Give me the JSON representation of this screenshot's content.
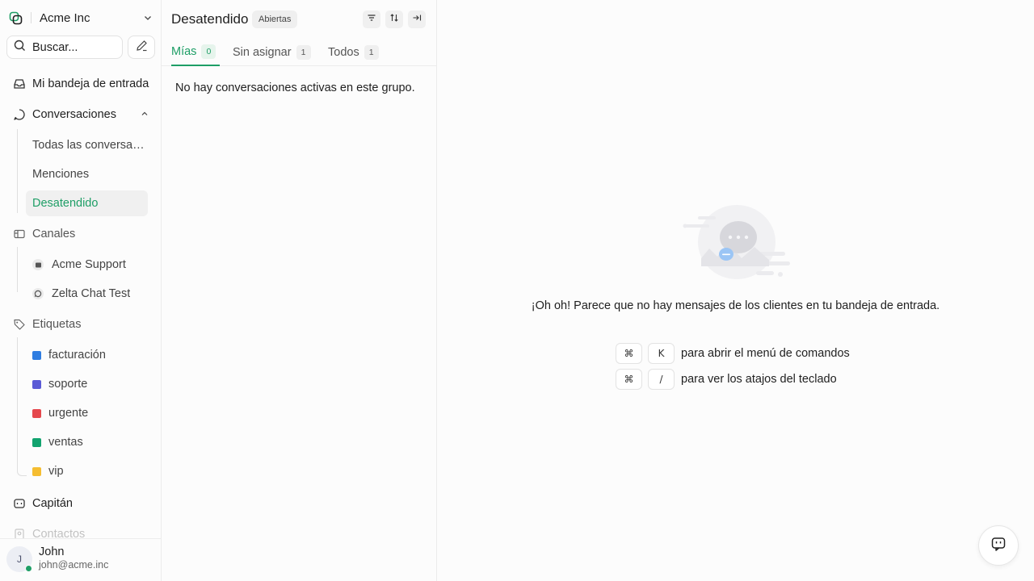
{
  "sidebar": {
    "account_name": "Acme Inc",
    "search_placeholder": "Buscar...",
    "nav": {
      "inbox": "Mi bandeja de entrada",
      "conversations": "Conversaciones",
      "channels": "Canales",
      "labels": "Etiquetas",
      "captain": "Capitán",
      "contacts": "Contactos"
    },
    "conversation_views": [
      "Todas las conversaciones",
      "Menciones",
      "Desatendido"
    ],
    "channels": [
      {
        "name": "Acme Support",
        "icon": "globe-icon"
      },
      {
        "name": "Zelta Chat Test",
        "icon": "whatsapp-icon"
      }
    ],
    "labels": [
      {
        "name": "facturación",
        "color": "#2f7de1"
      },
      {
        "name": "soporte",
        "color": "#5b5bd6"
      },
      {
        "name": "urgente",
        "color": "#e5484d"
      },
      {
        "name": "ventas",
        "color": "#12a36f"
      },
      {
        "name": "vip",
        "color": "#f5bd31"
      }
    ],
    "user": {
      "initial": "J",
      "name": "John",
      "email": "john@acme.inc"
    }
  },
  "list": {
    "title": "Desatendido",
    "status": "Abiertas",
    "tabs": [
      {
        "label": "Mías",
        "count": "0"
      },
      {
        "label": "Sin asignar",
        "count": "1"
      },
      {
        "label": "Todos",
        "count": "1"
      }
    ],
    "empty_message": "No hay conversaciones activas en este grupo."
  },
  "main": {
    "empty_message": "¡Oh oh! Parece que no hay mensajes de los clientes en tu bandeja de entrada.",
    "shortcuts": [
      {
        "keys": [
          "⌘",
          "K"
        ],
        "text": "para abrir el menú de comandos"
      },
      {
        "keys": [
          "⌘",
          "/"
        ],
        "text": "para ver los atajos del teclado"
      }
    ]
  },
  "colors": {
    "accent": "#1e9e66"
  }
}
